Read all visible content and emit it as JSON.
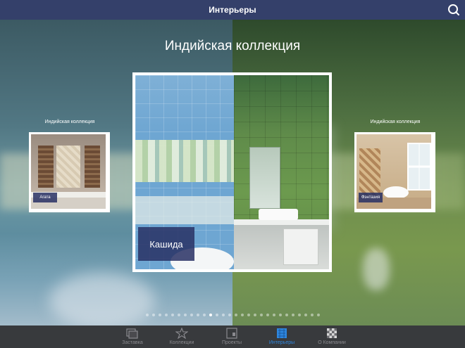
{
  "header": {
    "title": "Интерьеры"
  },
  "collection": {
    "title": "Индийская коллекция"
  },
  "main_card": {
    "label": "Кашида"
  },
  "left_card": {
    "caption": "Индийская коллекция",
    "label": "Агата"
  },
  "right_card": {
    "caption": "Индийская коллекция",
    "label": "Фэнтазия"
  },
  "pager": {
    "total": 28,
    "active": 10
  },
  "tabs": [
    {
      "label": "Заставка",
      "icon": "screensaver-icon"
    },
    {
      "label": "Коллекции",
      "icon": "star-icon"
    },
    {
      "label": "Проекты",
      "icon": "projects-icon"
    },
    {
      "label": "Интерьеры",
      "icon": "interiors-icon",
      "active": true
    },
    {
      "label": "О Компании",
      "icon": "company-icon"
    }
  ],
  "colors": {
    "header_bg": "#34406a",
    "accent": "#2e86de",
    "label_bg": "#283064"
  }
}
